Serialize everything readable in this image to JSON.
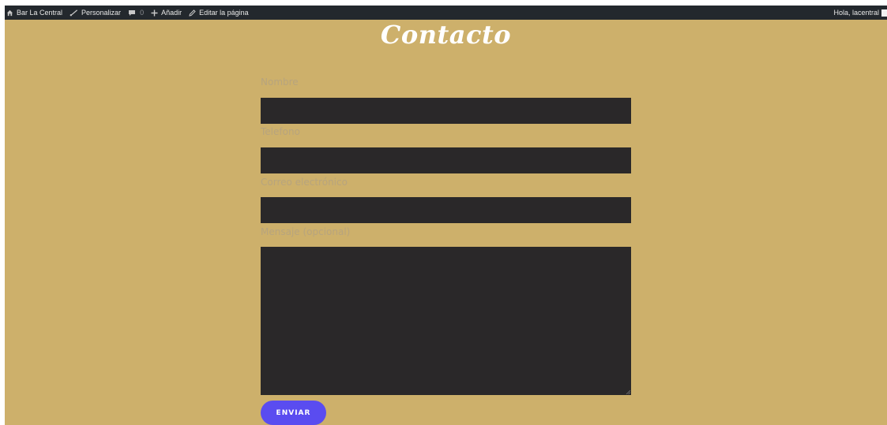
{
  "admin_bar": {
    "site_name": "Bar La Central",
    "customize": "Personalizar",
    "comments_count": "0",
    "add_new": "Añadir",
    "edit_page": "Editar la página",
    "greeting": "Hola, lacentral"
  },
  "page": {
    "title": "Contacto",
    "background_color": "#cdb06b"
  },
  "form": {
    "fields": [
      {
        "label": "Nombre",
        "value": ""
      },
      {
        "label": "Telefono",
        "value": ""
      },
      {
        "label": "Correo electrónico",
        "value": ""
      }
    ],
    "message": {
      "label": "Mensaje (opcional)",
      "value": ""
    },
    "submit_label": "ENVIAR",
    "submit_color": "#5a4cf0"
  }
}
